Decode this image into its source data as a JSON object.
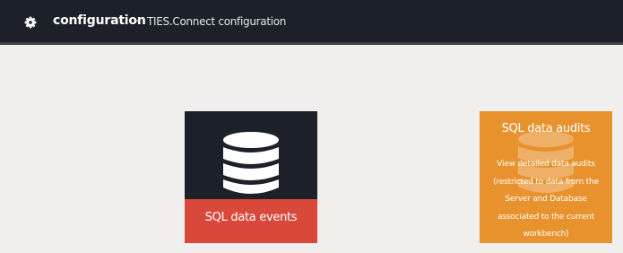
{
  "header": {
    "title": "configuration",
    "separator": "-",
    "subtitle": "TIES.Connect configuration",
    "icon": "gear-icon"
  },
  "tiles": [
    {
      "label": "SQL data events",
      "icon": "database-icon",
      "background": "#1b2029",
      "accent": "#d9493b"
    },
    {
      "label": "SQL data audits",
      "icon": "database-icon",
      "background": "#e8922e",
      "description": "View detailed data audits (restricted to data from the Server and Database associated to the current workbench)"
    }
  ]
}
